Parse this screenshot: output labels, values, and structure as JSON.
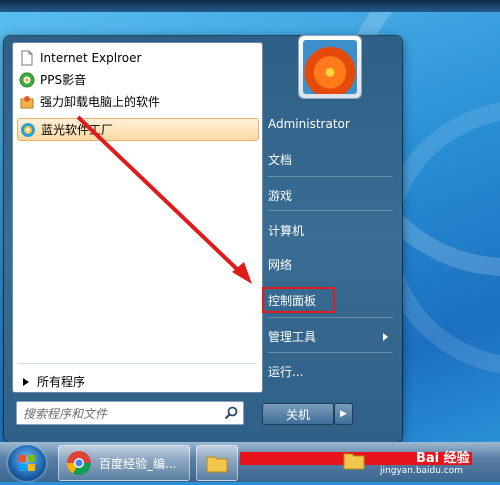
{
  "left_panel": {
    "items": [
      {
        "label": "Internet Explroer",
        "icon": "document-icon"
      },
      {
        "label": "PPS影音",
        "icon": "pps-player-icon"
      },
      {
        "label": "强力卸载电脑上的软件",
        "icon": "uninstaller-icon"
      },
      {
        "label": "蓝光软件工厂",
        "icon": "software-factory-icon",
        "selected": true
      }
    ],
    "all_programs": "所有程序",
    "search_placeholder": "搜索程序和文件"
  },
  "right_panel": {
    "user": "Administrator",
    "documents": "文档",
    "games": "游戏",
    "computer": "计算机",
    "network": "网络",
    "control_panel": "控制面板",
    "admin_tools": "管理工具",
    "run": "运行...",
    "shutdown": "关机"
  },
  "taskbar": {
    "task_baidu": "百度经验_编..."
  },
  "watermark": {
    "url": "jingyan.baidu.com",
    "brand": "Bai 经验"
  },
  "colors": {
    "highlight_box": "#e01b1b",
    "annotation_arrow": "#e01b1b"
  }
}
